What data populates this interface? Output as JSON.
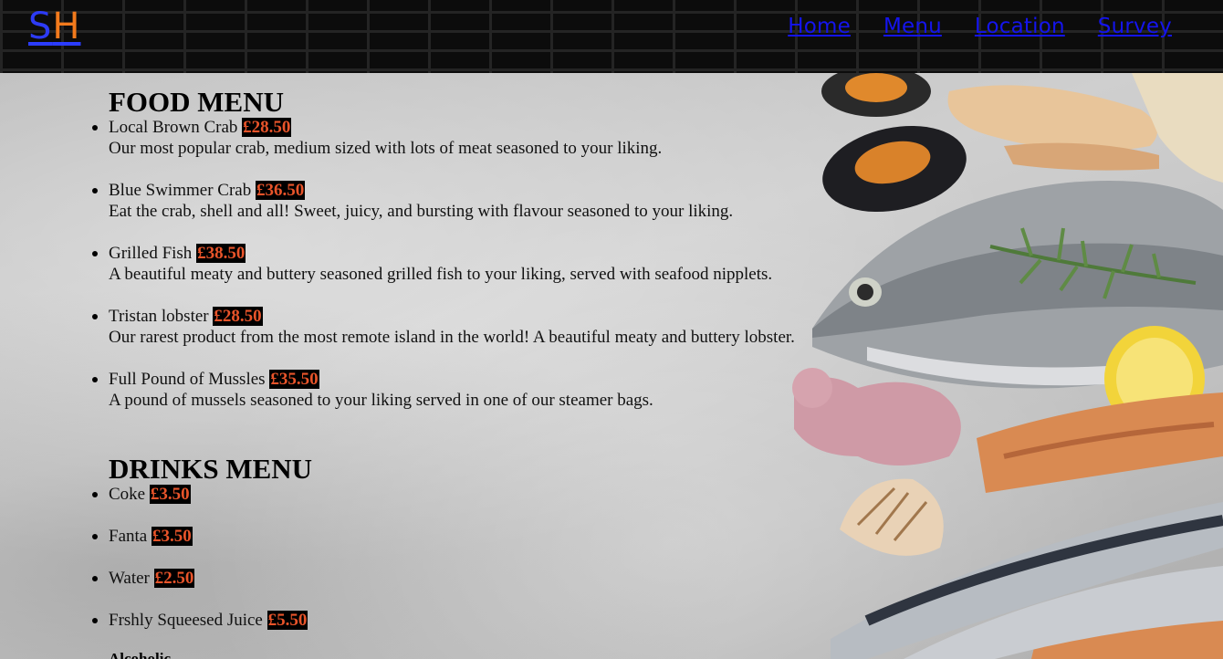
{
  "header": {
    "logo": {
      "s": "S",
      "h": "H"
    },
    "nav": [
      "Home",
      "Menu",
      "Location",
      "Survey"
    ]
  },
  "food_menu": {
    "title": "FOOD MENU",
    "items": [
      {
        "name": "Local Brown Crab",
        "price": "£28.50",
        "description": "Our most popular crab, medium sized with lots of meat seasoned to your liking."
      },
      {
        "name": "Blue Swimmer Crab",
        "price": "£36.50",
        "description": "Eat the crab, shell and all! Sweet, juicy, and bursting with flavour seasoned to your liking."
      },
      {
        "name": "Grilled Fish",
        "price": "£38.50",
        "description": "A beautiful meaty and buttery seasoned grilled fish to your liking, served with seafood nipplets."
      },
      {
        "name": "Tristan lobster",
        "price": "£28.50",
        "description": "Our rarest product from the most remote island in the world! A beautiful meaty and buttery lobster."
      },
      {
        "name": "Full Pound of Mussles",
        "price": "£35.50",
        "description": "A pound of mussels seasoned to your liking served in one of our steamer bags."
      }
    ]
  },
  "drinks_menu": {
    "title": "DRINKS MENU",
    "items": [
      {
        "name": "Coke",
        "price": "£3.50"
      },
      {
        "name": "Fanta",
        "price": "£3.50"
      },
      {
        "name": "Water",
        "price": "£2.50"
      },
      {
        "name": "Frshly Squeesed Juice",
        "price": "£5.50"
      }
    ],
    "alcoholic_label": "Alcoholic"
  },
  "colors": {
    "header_bg": "#0c0c0c",
    "logo_s": "#2d3bf5",
    "logo_h": "#f27a1c",
    "link": "#1414ee",
    "price": "#e8542a",
    "price_bg": "#000000"
  }
}
